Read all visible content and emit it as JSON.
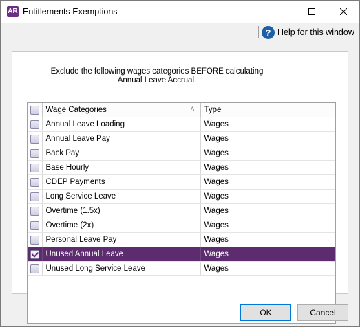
{
  "window": {
    "app_icon_text": "AR",
    "title": "Entitlements Exemptions",
    "minimize_icon": "minimize-icon",
    "maximize_icon": "maximize-icon",
    "close_icon": "close-icon"
  },
  "help": {
    "icon": "?",
    "label": "Help for this window"
  },
  "instructions": {
    "line1": "Exclude the following wages categories BEFORE calculating",
    "line2": "Annual Leave Accrual."
  },
  "grid": {
    "columns": {
      "category": "Wage Categories",
      "sort_indicator": "Δ",
      "type": "Type"
    },
    "rows": [
      {
        "category": "Annual Leave Loading",
        "type": "Wages",
        "checked": false,
        "selected": false
      },
      {
        "category": "Annual Leave Pay",
        "type": "Wages",
        "checked": false,
        "selected": false
      },
      {
        "category": "Back Pay",
        "type": "Wages",
        "checked": false,
        "selected": false
      },
      {
        "category": "Base Hourly",
        "type": "Wages",
        "checked": false,
        "selected": false
      },
      {
        "category": "CDEP Payments",
        "type": "Wages",
        "checked": false,
        "selected": false
      },
      {
        "category": "Long Service Leave",
        "type": "Wages",
        "checked": false,
        "selected": false
      },
      {
        "category": "Overtime (1.5x)",
        "type": "Wages",
        "checked": false,
        "selected": false
      },
      {
        "category": "Overtime (2x)",
        "type": "Wages",
        "checked": false,
        "selected": false
      },
      {
        "category": "Personal Leave Pay",
        "type": "Wages",
        "checked": false,
        "selected": false
      },
      {
        "category": "Unused Annual Leave",
        "type": "Wages",
        "checked": true,
        "selected": true
      },
      {
        "category": "Unused Long Service Leave",
        "type": "Wages",
        "checked": false,
        "selected": false
      }
    ]
  },
  "buttons": {
    "ok": "OK",
    "cancel": "Cancel"
  },
  "colors": {
    "accent": "#6b2d86",
    "selected_row": "#5c2c6e"
  }
}
